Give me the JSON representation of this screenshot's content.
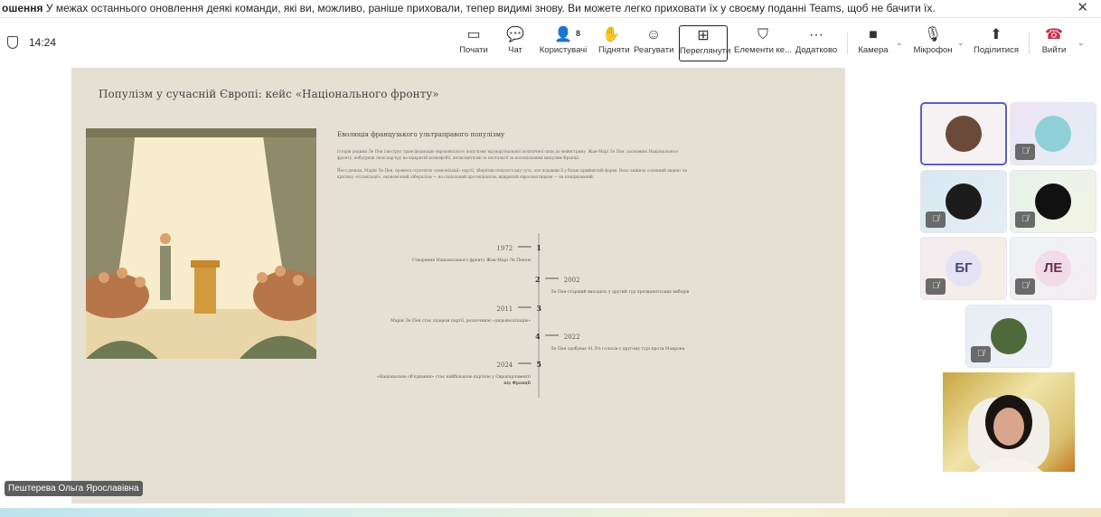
{
  "banner": {
    "prefix": "ошення",
    "text": "У межах останнього оновлення деякі команди, які ви, можливо, раніше приховали, тепер видимі знову. Ви можете легко приховати їх у своєму поданні Teams, щоб не бачити їх.",
    "close": "✕"
  },
  "meeting": {
    "time": "14:24"
  },
  "toolbar": [
    {
      "label": "Почати",
      "icon": "share-screen-icon",
      "glyph": "▭"
    },
    {
      "label": "Чат",
      "icon": "chat-icon",
      "glyph": "💬"
    },
    {
      "label": "Користувачі",
      "icon": "people-icon",
      "glyph": "👤",
      "badge": "8"
    },
    {
      "label": "Підняти",
      "icon": "raise-hand-icon",
      "glyph": "✋"
    },
    {
      "label": "Реагувати",
      "icon": "react-icon",
      "glyph": "☺"
    },
    {
      "label": "Переглянути",
      "icon": "view-icon",
      "glyph": "⊞"
    },
    {
      "label": "Елементи ке...",
      "icon": "shield-settings-icon",
      "glyph": "⛉"
    },
    {
      "label": "Додатково",
      "icon": "more-icon",
      "glyph": "···"
    },
    {
      "label": "Камера",
      "icon": "camera-icon",
      "glyph": "■"
    },
    {
      "label": "Мікрофон",
      "icon": "microphone-icon",
      "glyph": "🎙"
    },
    {
      "label": "Поділитися",
      "icon": "share-icon",
      "glyph": "⬆"
    },
    {
      "label": "Вийти",
      "icon": "hang-up-icon",
      "glyph": "☎"
    }
  ],
  "slide": {
    "title": "Популізм у сучасній Європі: кейс «Національного фронту»",
    "subtitle": "Еволюція французького ультраправого популізму",
    "para1": "Історія родини Ле Пен ілюструє трансформацію європейського популізму від маргінальної політичної сили до мейнстриму. Жан-Марі Ле Пен, засновник Національного фронту, побудував свою кар'єру на відкритій ксенофобії, антисемітизмі та ностальгії за колоніальним минулим Франції.",
    "para2": "Його донька, Марін Ле Пен, провела стратегію «демонізації» партії, зберігши популістську суть, але подавши її у більш прийнятній формі. Вона змінила основний акцент на критику «ісламізації», економічний лібералізм — на соціальний протекціонізм, відкритий євроскептицизм — на поміркований.",
    "timeline": [
      {
        "num": "1",
        "year": "1972",
        "desc": "Створення Національного фронту Жан-Марі Ле Пеном"
      },
      {
        "num": "2",
        "year": "2002",
        "desc": "Ле Пен-старший виходить у другий тур президентських виборів"
      },
      {
        "num": "3",
        "year": "2011",
        "desc": "Марін Ле Пен стає лідером партії, розпочинає «дедьяволізацію»"
      },
      {
        "num": "4",
        "year": "2022",
        "desc": "Ле Пен здобуває 41,5% голосів у другому турі проти Макрона"
      },
      {
        "num": "5",
        "year": "2024",
        "desc": "«Національне об'єднання» стає найбільшою партією у Європарламенті",
        "desc2": "від Франції"
      }
    ]
  },
  "participants": [
    {
      "initials": "",
      "muted": false,
      "selected": true,
      "color": "#6b4a3a"
    },
    {
      "initials": "",
      "muted": true,
      "color": "#8fd0d8"
    },
    {
      "initials": "",
      "muted": true,
      "color": "#1c1c1c"
    },
    {
      "initials": "",
      "muted": true,
      "color": "#111111"
    },
    {
      "initials": "БГ",
      "muted": true,
      "color": "#e4e2f4"
    },
    {
      "initials": "ЛЕ",
      "muted": true,
      "color": "#f0dbe6"
    },
    {
      "initials": "",
      "muted": true,
      "color": "#4f6a3a"
    }
  ],
  "speaker": {
    "name": "Пештерева Ольга Ярославівна"
  }
}
